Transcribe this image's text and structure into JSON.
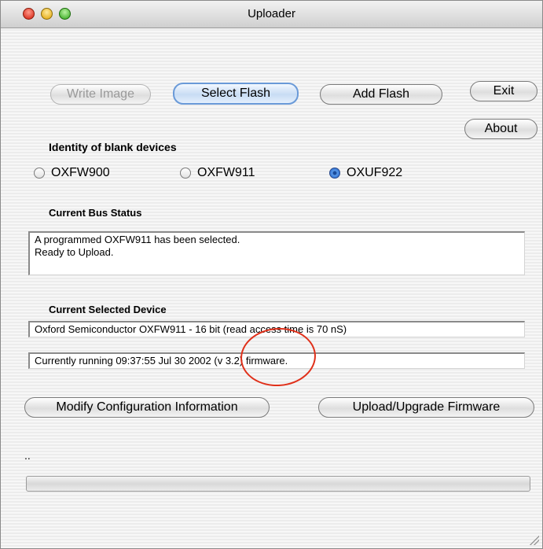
{
  "window": {
    "title": "Uploader"
  },
  "buttons": {
    "write_image": "Write Image",
    "select_flash": "Select Flash",
    "add_flash": "Add Flash",
    "exit": "Exit",
    "about": "About",
    "modify_config": "Modify Configuration Information",
    "upload_firmware": "Upload/Upgrade Firmware"
  },
  "blank_devices": {
    "label": "Identity of blank devices",
    "options": [
      {
        "label": "OXFW900",
        "selected": false
      },
      {
        "label": "OXFW911",
        "selected": false
      },
      {
        "label": "OXUF922",
        "selected": true
      }
    ]
  },
  "bus_status": {
    "label": "Current Bus Status",
    "line1": "A programmed OXFW911 has been selected.",
    "line2": "Ready to Upload."
  },
  "selected_device": {
    "label": "Current Selected Device",
    "device_info": "Oxford Semiconductor OXFW911 - 16 bit  (read access time is 70 nS)",
    "firmware_info": "Currently running 09:37:55 Jul 30 2002 (v 3.2)  firmware."
  },
  "status_text": "..",
  "progress": {
    "value": 0
  },
  "colors": {
    "annotation": "#e0301a",
    "default_button": "#6a9ad8"
  }
}
